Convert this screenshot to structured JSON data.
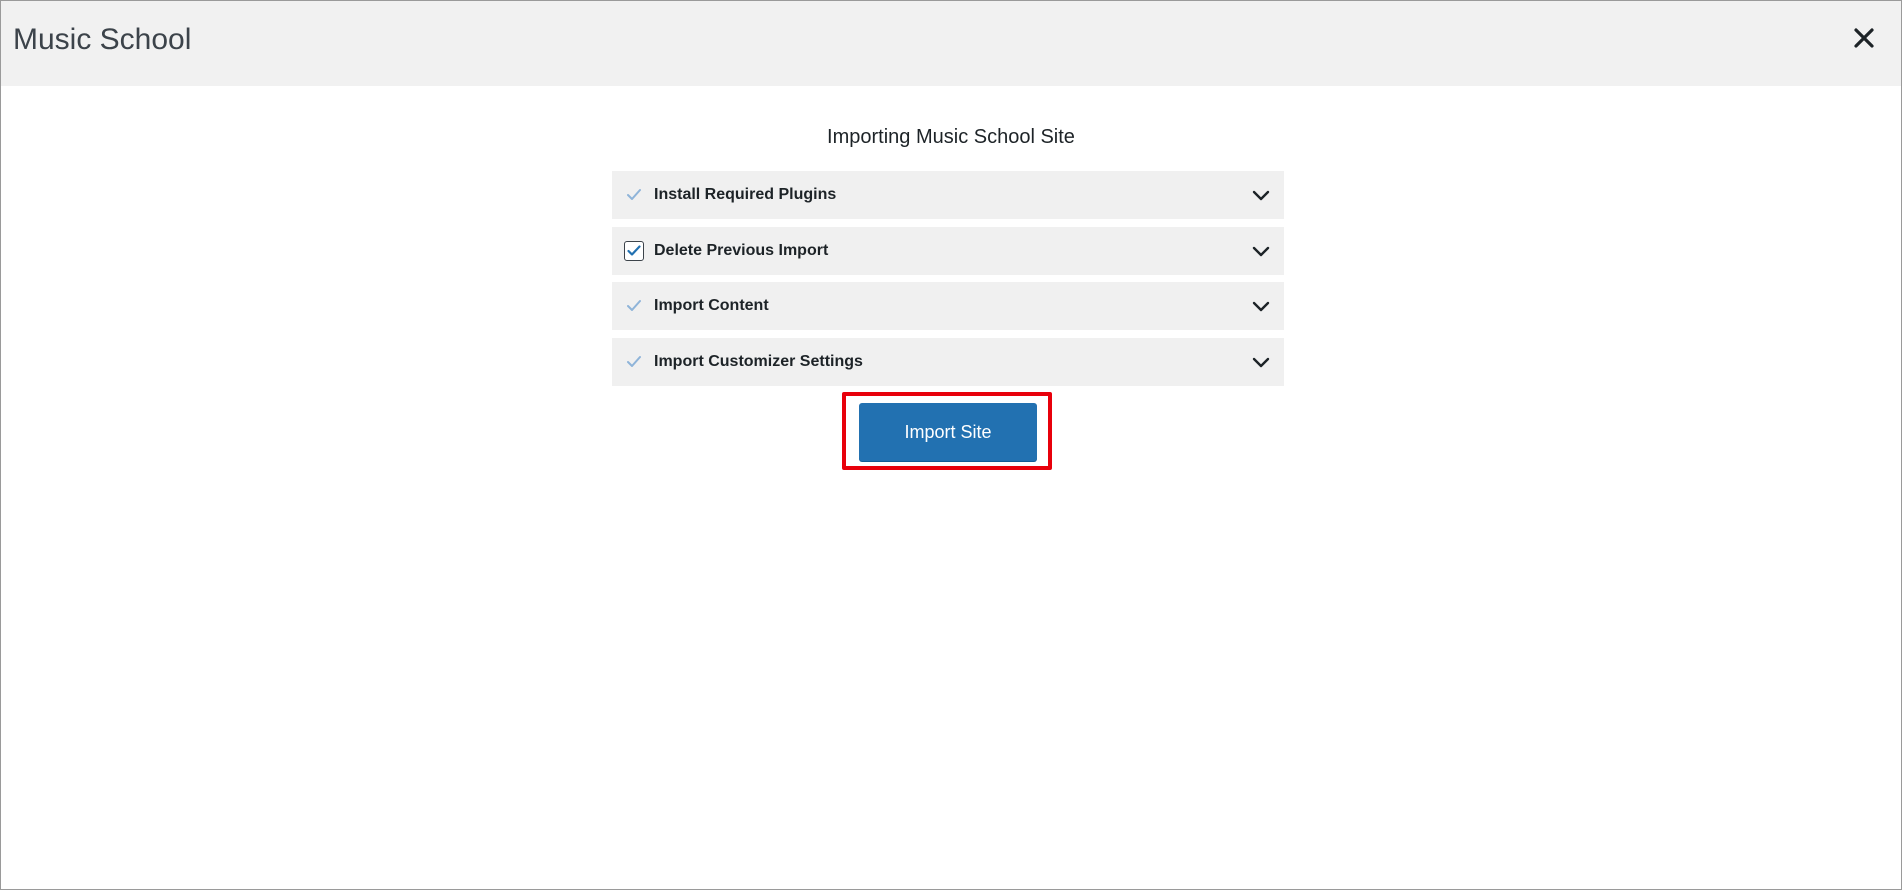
{
  "header": {
    "title": "Music School",
    "close_icon": "close-icon"
  },
  "main": {
    "title": "Importing Music School Site",
    "steps": [
      {
        "label": "Install Required Plugins",
        "checked": true,
        "style": "faint-check",
        "icon": "chevron-down-icon"
      },
      {
        "label": "Delete Previous Import",
        "checked": true,
        "style": "checkbox",
        "icon": "chevron-down-icon"
      },
      {
        "label": "Import Content",
        "checked": true,
        "style": "faint-check",
        "icon": "chevron-down-icon"
      },
      {
        "label": "Import Customizer Settings",
        "checked": true,
        "style": "faint-check",
        "icon": "chevron-down-icon"
      }
    ],
    "import_button_label": "Import Site"
  },
  "colors": {
    "header_bg": "#f1f1f1",
    "step_bg": "#f0f0f0",
    "button_bg": "#2271b1",
    "highlight": "#e8000b",
    "faint_check": "#8fb4d9",
    "check": "#2271b1"
  }
}
